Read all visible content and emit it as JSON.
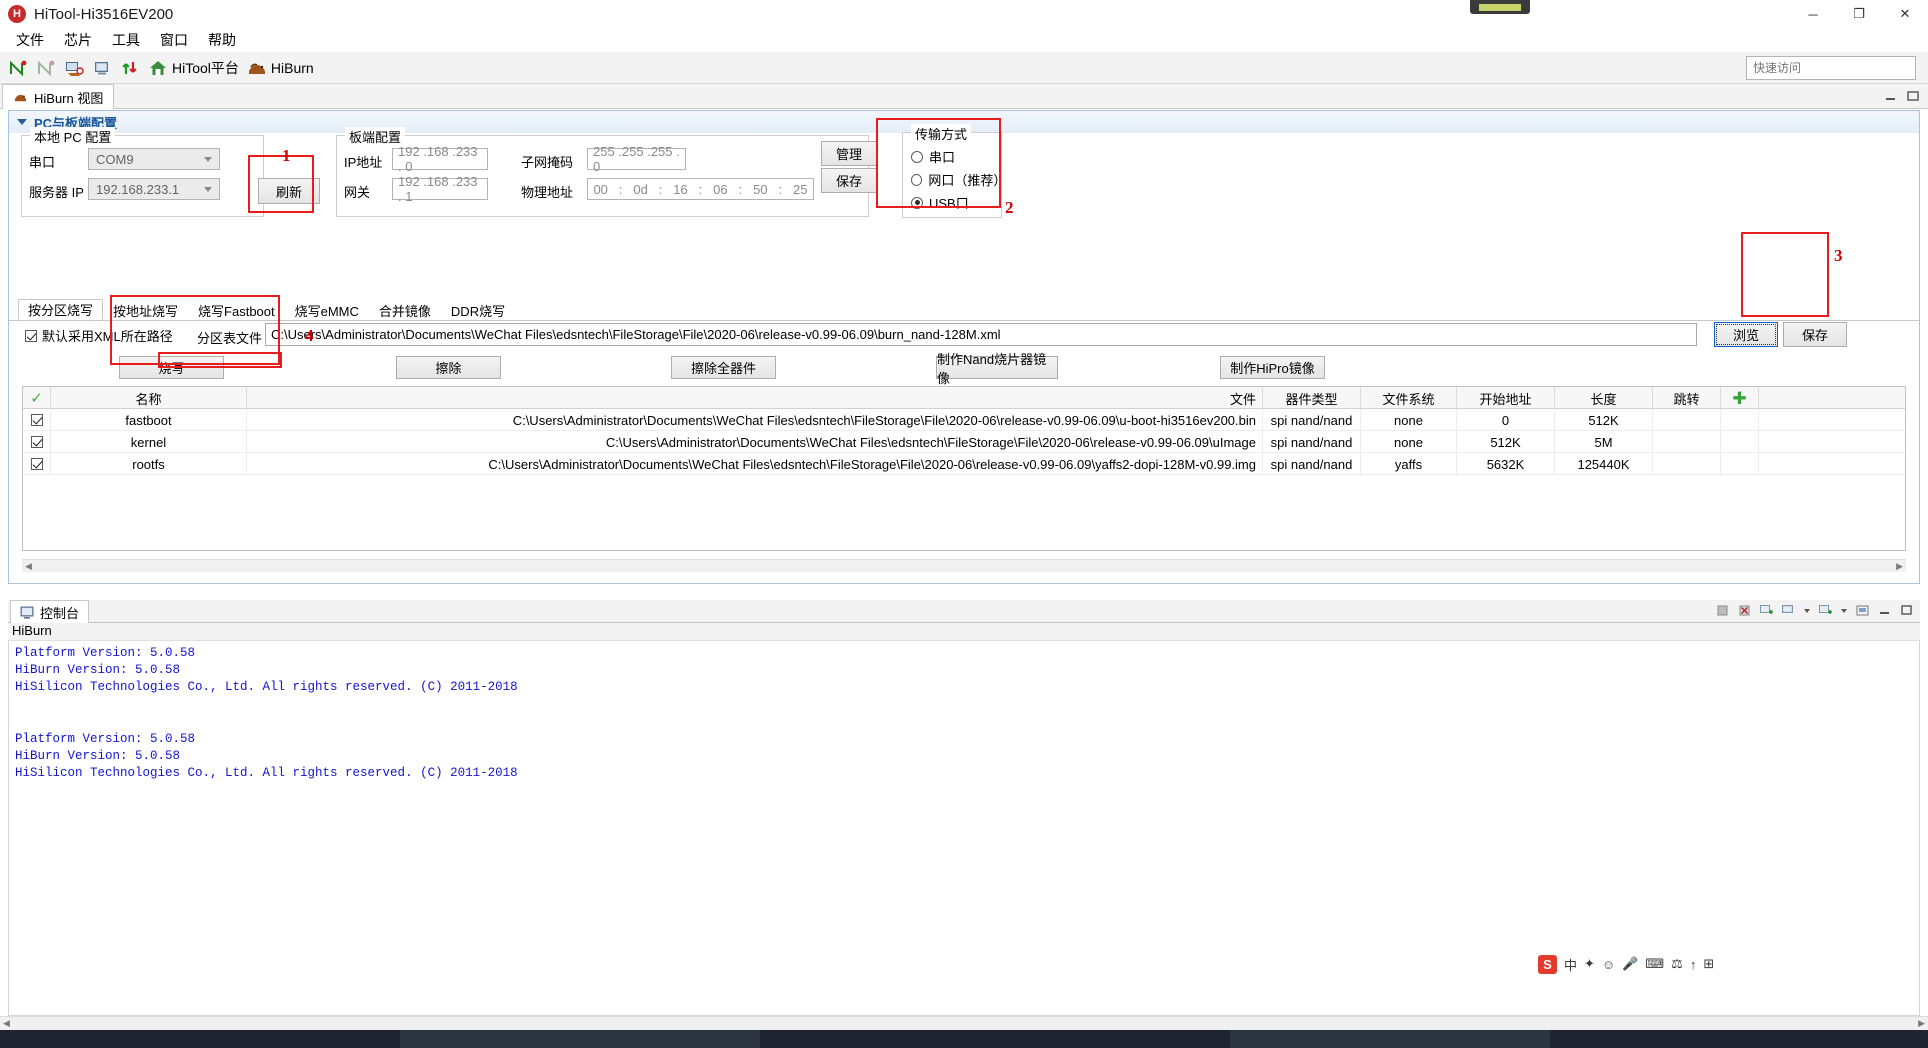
{
  "window": {
    "title": "HiTool-Hi3516EV200",
    "app_icon": "hitool-icon",
    "minimize": "─",
    "maximize": "❐",
    "close": "✕"
  },
  "menubar": {
    "items": [
      "文件",
      "芯片",
      "工具",
      "窗口",
      "帮助"
    ]
  },
  "toolbar": {
    "items": [
      {
        "icon": "network-scan-icon",
        "label": ""
      },
      {
        "icon": "network-scan-disabled-icon",
        "label": ""
      },
      {
        "icon": "serial-config-icon",
        "label": ""
      },
      {
        "icon": "terminal-icon",
        "label": ""
      },
      {
        "icon": "upload-download-icon",
        "label": ""
      },
      {
        "icon": "home-icon",
        "label": "HiTool平台"
      },
      {
        "icon": "hiburn-icon",
        "label": "HiBurn"
      }
    ],
    "quick_access_placeholder": "快速访问"
  },
  "view_tab": {
    "label": "HiBurn 视图",
    "icon": "hiburn-icon"
  },
  "panel": {
    "header": "PC与板端配置",
    "local_pc": {
      "title": "本地 PC 配置",
      "serial_label": "串口",
      "serial_value": "COM9",
      "server_ip_label": "服务器 IP",
      "server_ip_value": "192.168.233.1",
      "refresh_button": "刷新"
    },
    "board": {
      "title": "板端配置",
      "ip_label": "IP地址",
      "ip_value": "192 .168 .233 .  0",
      "mask_label": "子网掩码",
      "mask_value": "255 .255 .255 .  0",
      "gateway_label": "网关",
      "gateway_value": "192 .168 .233 .  1",
      "mac_label": "物理地址",
      "mac_octets": [
        "00",
        "0d",
        "16",
        "06",
        "50",
        "25"
      ],
      "manage_button": "管理",
      "save_button": "保存"
    },
    "transport": {
      "title": "传输方式",
      "options": [
        {
          "label": "串口",
          "selected": false
        },
        {
          "label": "网口（推荐）",
          "selected": false
        },
        {
          "label": "USB口",
          "selected": true
        }
      ]
    }
  },
  "tabs": [
    {
      "label": "按分区烧写",
      "active": true
    },
    {
      "label": "按地址烧写",
      "active": false
    },
    {
      "label": "烧写Fastboot",
      "active": false
    },
    {
      "label": "烧写eMMC",
      "active": false
    },
    {
      "label": "合并镜像",
      "active": false
    },
    {
      "label": "DDR烧写",
      "active": false
    }
  ],
  "xml_row": {
    "checkbox_label": "默认采用XML所在路径",
    "checkbox_checked": true,
    "partition_file_label": "分区表文件",
    "path_value": "C:\\Users\\Administrator\\Documents\\WeChat Files\\edsntech\\FileStorage\\File\\2020-06\\release-v0.99-06.09\\burn_nand-128M.xml",
    "browse_button": "浏览",
    "save_button": "保存"
  },
  "action_buttons": [
    "烧写",
    "擦除",
    "擦除全器件",
    "制作Nand烧片器镜像",
    "制作HiPro镜像"
  ],
  "table": {
    "headers": [
      "",
      "名称",
      "文件",
      "器件类型",
      "文件系统",
      "开始地址",
      "长度",
      "跳转",
      ""
    ],
    "add_icon": "add-row-icon",
    "header_check_icon": "select-all-check-icon",
    "rows": [
      {
        "checked": true,
        "name": "fastboot",
        "file": "C:\\Users\\Administrator\\Documents\\WeChat Files\\edsntech\\FileStorage\\File\\2020-06\\release-v0.99-06.09\\u-boot-hi3516ev200.bin",
        "device": "spi nand/nand",
        "fs": "none",
        "start": "0",
        "length": "512K",
        "jump": ""
      },
      {
        "checked": true,
        "name": "kernel",
        "file": "C:\\Users\\Administrator\\Documents\\WeChat Files\\edsntech\\FileStorage\\File\\2020-06\\release-v0.99-06.09\\uImage",
        "device": "spi nand/nand",
        "fs": "none",
        "start": "512K",
        "length": "5M",
        "jump": ""
      },
      {
        "checked": true,
        "name": "rootfs",
        "file": "C:\\Users\\Administrator\\Documents\\WeChat Files\\edsntech\\FileStorage\\File\\2020-06\\release-v0.99-06.09\\yaffs2-dopi-128M-v0.99.img",
        "device": "spi nand/nand",
        "fs": "yaffs",
        "start": "5632K",
        "length": "125440K",
        "jump": ""
      }
    ]
  },
  "annotations": [
    {
      "num": "1"
    },
    {
      "num": "2"
    },
    {
      "num": "3"
    },
    {
      "num": "4"
    }
  ],
  "console": {
    "tab_label": "控制台",
    "tab_icon": "console-icon",
    "source_label": "HiBurn",
    "text": "Platform Version: 5.0.58\nHiBurn Version: 5.0.58\nHiSilicon Technologies Co., Ltd. All rights reserved. (C) 2011-2018\n\n\nPlatform Version: 5.0.58\nHiBurn Version: 5.0.58\nHiSilicon Technologies Co., Ltd. All rights reserved. (C) 2011-2018",
    "text_color": "#1414d2",
    "tool_icons": [
      "terminate-icon",
      "remove-icon",
      "new-console-icon",
      "display-selected-console-icon",
      "dropdown-icon",
      "open-console-icon",
      "dropdown2-icon",
      "scroll-lock-icon",
      "minimize-icon",
      "maximize-icon"
    ]
  },
  "ime": {
    "logo": "S",
    "items": [
      "中",
      "✦",
      "☺",
      "🎤",
      "⌨",
      "⚖",
      "↑",
      "⊞"
    ]
  }
}
